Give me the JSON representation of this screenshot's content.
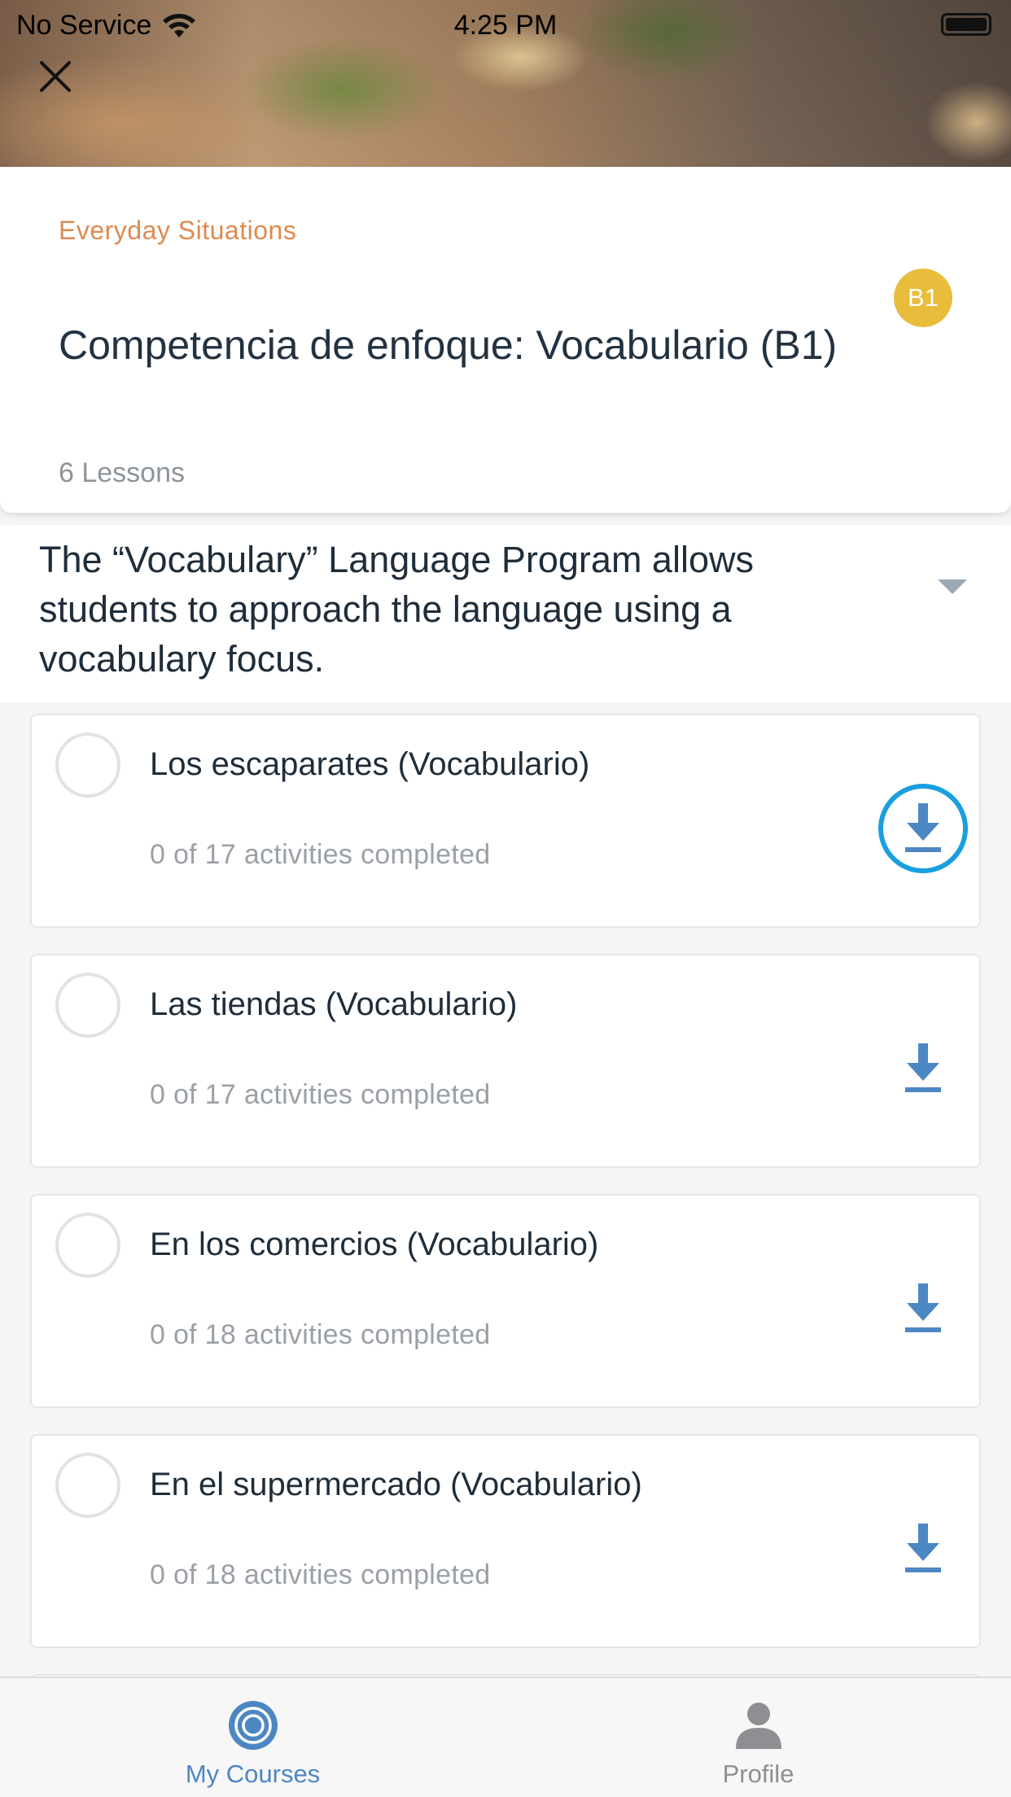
{
  "status_bar": {
    "carrier": "No Service",
    "time": "4:25 PM"
  },
  "course": {
    "category": "Everyday Situations",
    "title": "Competencia de enfoque: Vocabulario (B1)",
    "level_badge": "B1",
    "lesson_count": "6 Lessons",
    "description": "The “Vocabulary” Language Program allows students to approach the language using a vocabulary focus."
  },
  "lessons": [
    {
      "title": "Los escaparates (Vocabulario)",
      "progress": "0 of 17 activities completed"
    },
    {
      "title": "Las tiendas (Vocabulario)",
      "progress": "0 of 17 activities completed"
    },
    {
      "title": "En los comercios (Vocabulario)",
      "progress": "0 of 18 activities completed"
    },
    {
      "title": "En el supermercado (Vocabulario)",
      "progress": "0 of 18 activities completed"
    }
  ],
  "tab_bar": {
    "my_courses": "My Courses",
    "profile": "Profile"
  },
  "colors": {
    "accent": "#4d87c3",
    "category": "#de8a4f",
    "badge": "#e8bd3c",
    "download_highlight": "#199fdf"
  }
}
